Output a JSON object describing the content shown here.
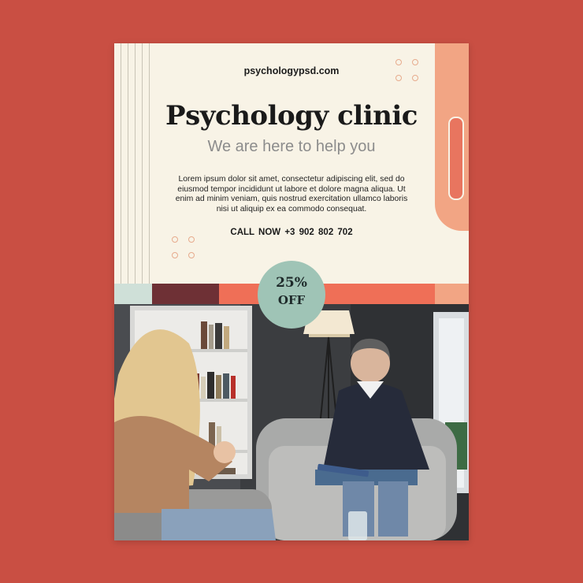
{
  "poster": {
    "website": "psychologypsd.com",
    "title": "Psychology clinic",
    "subtitle": "We are here to help you",
    "body": "Lorem ipsum dolor sit amet, consectetur adipiscing elit, sed do eiusmod tempor incididunt ut labore et dolore magna aliqua. Ut enim ad minim veniam, quis nostrud exercitation ullamco laboris nisi ut aliquip ex ea commodo consequat.",
    "call_to_action": "CALL NOW  +3 902 802 702",
    "badge": {
      "percent": "25%",
      "label": "OFF"
    }
  },
  "colors": {
    "background": "#c94f43",
    "poster": "#f8f3e6",
    "accent_peach": "#f2a584",
    "accent_coral": "#ef6f57",
    "accent_maroon": "#6e3035",
    "accent_mint": "#9fc4b6"
  },
  "photo": {
    "subject": "therapist-session-photo"
  }
}
